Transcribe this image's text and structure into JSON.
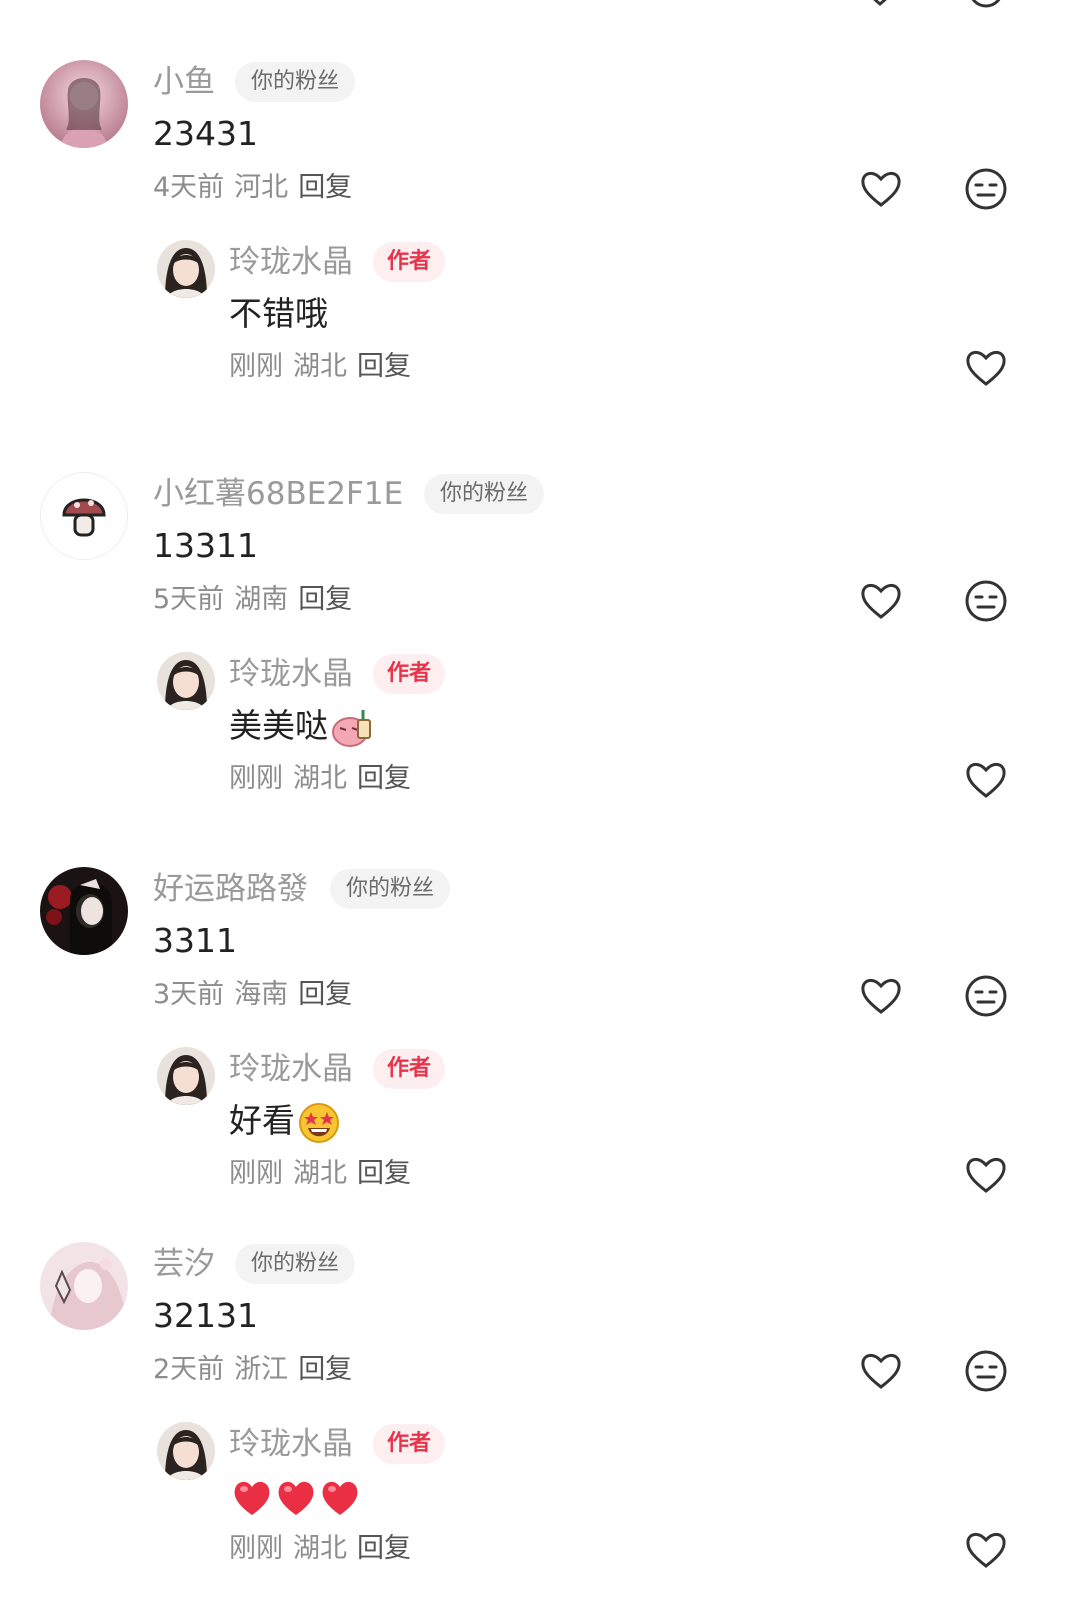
{
  "comments": [
    {
      "user": "小鱼",
      "fan_badge": "你的粉丝",
      "text": "23431",
      "time": "4天前",
      "location": "河北",
      "reply_label": "回复",
      "reply": {
        "user": "玲珑水晶",
        "author_badge": "作者",
        "text": "不错哦",
        "time": "刚刚",
        "location": "湖北",
        "reply_label": "回复"
      }
    },
    {
      "user": "小红薯68BE2F1E",
      "fan_badge": "你的粉丝",
      "text": "13311",
      "time": "5天前",
      "location": "湖南",
      "reply_label": "回复",
      "reply": {
        "user": "玲珑水晶",
        "author_badge": "作者",
        "text": "美美哒",
        "time": "刚刚",
        "location": "湖北",
        "reply_label": "回复"
      }
    },
    {
      "user": "好运路路發",
      "fan_badge": "你的粉丝",
      "text": "3311",
      "time": "3天前",
      "location": "海南",
      "reply_label": "回复",
      "reply": {
        "user": "玲珑水晶",
        "author_badge": "作者",
        "text": "好看",
        "time": "刚刚",
        "location": "湖北",
        "reply_label": "回复"
      }
    },
    {
      "user": "芸汐",
      "fan_badge": "你的粉丝",
      "text": "32131",
      "time": "2天前",
      "location": "浙江",
      "reply_label": "回复",
      "reply": {
        "user": "玲珑水晶",
        "author_badge": "作者",
        "text": "",
        "time": "刚刚",
        "location": "湖北",
        "reply_label": "回复"
      }
    }
  ],
  "icons": {
    "like": "heart-icon",
    "dislike": "neutral-face-icon",
    "reply_emojis": [
      "pink-blob-emoji",
      "star-struck-emoji",
      "red-heart-emoji"
    ]
  },
  "colors": {
    "author_badge": "#e8344a",
    "author_badge_bg": "#fdeef0",
    "fan_badge_bg": "#f3f3f3",
    "name": "#9a9a9a",
    "text": "#222222"
  }
}
